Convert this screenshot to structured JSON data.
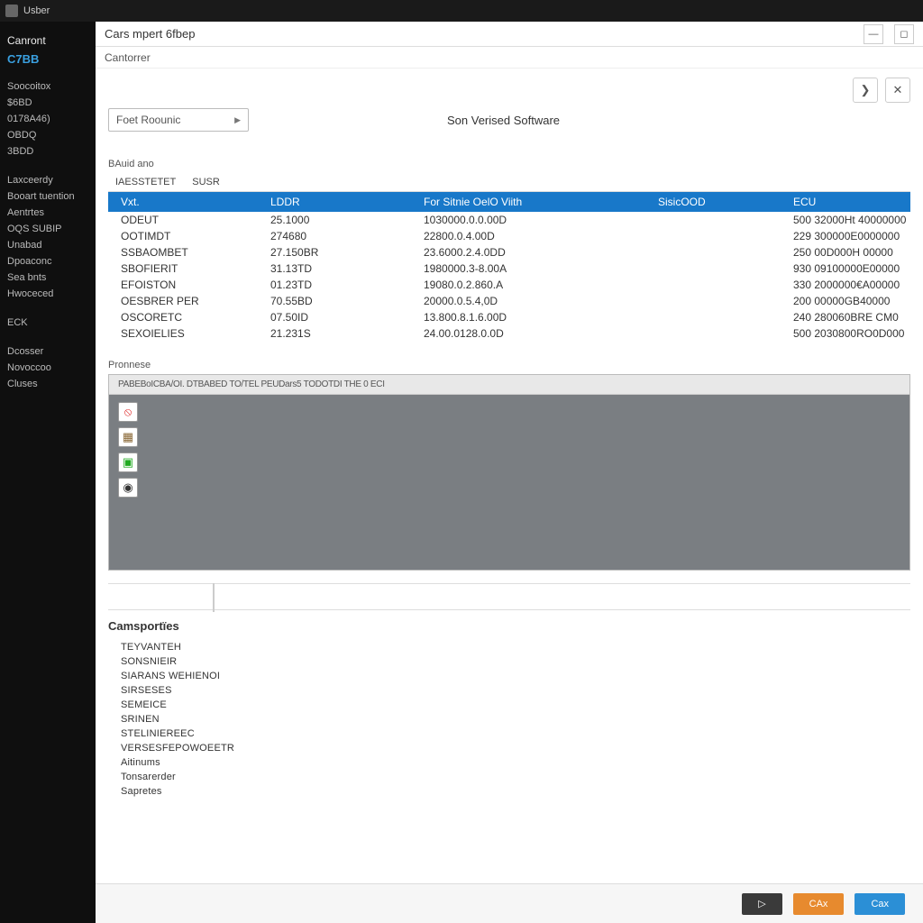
{
  "titlebar": {
    "label": "Usber"
  },
  "sidebar": {
    "head": "Canront",
    "brand": "C7BB",
    "group1": [
      "Soocoitox",
      "$6BD",
      "0178A46)",
      "OBDQ",
      "3BDD"
    ],
    "group2": [
      "Laxceerdy",
      "Booart tuention",
      "Aentrtes",
      "OQS SUBIP",
      "Unabad",
      "Dpoaconc",
      "Sea bnts",
      "Hwoceced"
    ],
    "group3": [
      "ECK"
    ],
    "group4": [
      "Dcosser",
      "Novoccoo",
      "Cluses"
    ]
  },
  "header": {
    "title": "Cars mpert 6fbep",
    "subtitle": "Cantorrer"
  },
  "toolbar": {
    "dropdown": "Foet Roounic",
    "sw_label": "Son Verised Software"
  },
  "table": {
    "section": "BAuid ano",
    "tabs": [
      "IAESSTETET",
      "SUSR"
    ],
    "headers": {
      "c1": "Vxt.",
      "c2": "LDDR",
      "c3": "For Sitnie OelO Viith",
      "c4": "SisicOOD",
      "c5": "ECU"
    },
    "rows": [
      {
        "c1": "ODEUT",
        "c2": "25.1000",
        "c3": "1030000.0.0.00D",
        "c4": "",
        "c5": "500 32000Ht 40000000"
      },
      {
        "c1": "OOTIMDT",
        "c2": "274680",
        "c3": "22800.0.4.00D",
        "c4": "",
        "c5": "229 300000E0000000"
      },
      {
        "c1": "SSBAOMBET",
        "c2": "27.150BR",
        "c3": "23.6000.2.4.0DD",
        "c4": "",
        "c5": "250 00D000H 00000"
      },
      {
        "c1": "SBOFIERIT",
        "c2": "31.13TD",
        "c3": "1980000.3-8.00A",
        "c4": "",
        "c5": "930 09100000E00000"
      },
      {
        "c1": "EFOISTON",
        "c2": "01.23TD",
        "c3": "19080.0.2.860.A",
        "c4": "",
        "c5": "330 2000000€A00000"
      },
      {
        "c1": "OESBRER PER",
        "c2": "70.55BD",
        "c3": "20000.0.5.4,0D",
        "c4": "",
        "c5": "200 00000GB40000"
      },
      {
        "c1": "OSCORETC",
        "c2": "07.50ID",
        "c3": "13.800.8.1.6.00D",
        "c4": "",
        "c5": "240 280060BRE CM0"
      },
      {
        "c1": "SEXOIELIES",
        "c2": "21.231S",
        "c3": "24.00.0128.0.0D",
        "c4": "",
        "c5": "500 2030800RO0D000"
      }
    ]
  },
  "preview": {
    "label": "Pronnese",
    "header": "PABEBoICBA/OI. DTBABED TO/TEL PEUDars5 TODOTDI THE 0 ECI"
  },
  "components": {
    "title": "Camsportïes",
    "items": [
      "TeyVANTEH",
      "SONSNIEIR",
      "Siarans WEHIENOI",
      "SIRSESES",
      "SEMEICE",
      "SRINEN",
      "STELINIEREEC",
      "VersEsFEPOWOEETR",
      "Aitinums",
      "Tonsarerder",
      "Sapretes"
    ]
  },
  "buttons": {
    "dark": "▷",
    "orange": "CAx",
    "blue": "Cax"
  }
}
